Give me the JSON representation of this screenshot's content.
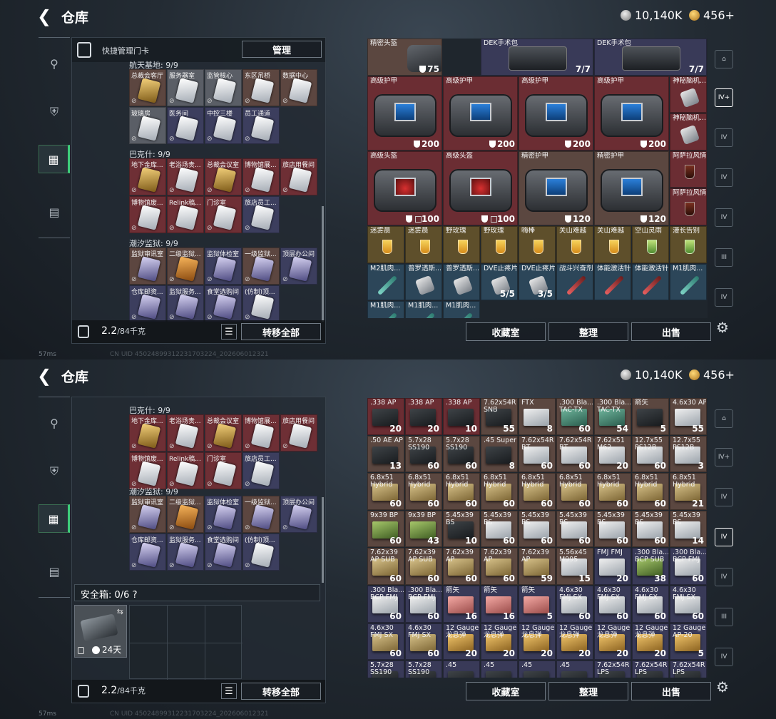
{
  "top": {
    "title": "仓库",
    "silver": "10,140K",
    "gold": "456+"
  },
  "left_panel": {
    "quick_title": "快捷管理门卡",
    "manage": "管理",
    "weight_value": "2.2",
    "weight_unit": "/84千克",
    "transfer_all": "转移全部",
    "groups": [
      {
        "title": "航天基地: 9/9",
        "keys": [
          [
            "总裁会客厅",
            "gold",
            "brown"
          ],
          [
            "服务器室",
            "white",
            "gray"
          ],
          [
            "监管核心",
            "white",
            "gray"
          ],
          [
            "东区吊桥",
            "white",
            "brown"
          ],
          [
            "数据中心",
            "white",
            "brown"
          ],
          [
            "玻璃房",
            "white",
            "gray"
          ],
          [
            "医务间",
            "white",
            "purple"
          ],
          [
            "中控三楼",
            "white",
            "purple"
          ],
          [
            "员工通道",
            "white",
            "purple"
          ]
        ]
      },
      {
        "title": "巴克什: 9/9",
        "keys": [
          [
            "地下金库...",
            "gold",
            "red"
          ],
          [
            "老浴场贵...",
            "white",
            "red"
          ],
          [
            "总裁会议室",
            "gold",
            "red"
          ],
          [
            "博物馆展...",
            "white",
            "red"
          ],
          [
            "旅店用餐间",
            "white",
            "red"
          ],
          [
            "博物馆废...",
            "white",
            "red"
          ],
          [
            "Relink稿...",
            "white",
            "red"
          ],
          [
            "门诊室",
            "white",
            "red"
          ],
          [
            "旅店员工...",
            "white",
            "purple"
          ]
        ]
      },
      {
        "title": "潮汐监狱: 9/9",
        "keys": [
          [
            "监狱审讯室",
            "purple",
            "brown"
          ],
          [
            "二级监狱...",
            "orange",
            "brown"
          ],
          [
            "监狱体检室",
            "purple",
            "purple"
          ],
          [
            "一级监狱...",
            "purple",
            "brown"
          ],
          [
            "顶层办公间",
            "purple",
            "purple"
          ],
          [
            "仓库邮资...",
            "purple",
            "purple"
          ],
          [
            "监狱服务...",
            "purple",
            "purple"
          ],
          [
            "食堂选购间",
            "purple",
            "purple"
          ],
          [
            "(仿制)顶...",
            "white",
            "purple"
          ]
        ]
      }
    ],
    "safe_title": "安全箱: 0/6",
    "safe_help": "?",
    "safe_time": "24天"
  },
  "right_buttons": {
    "collection": "收藏室",
    "sort": "整理",
    "sell": "出售"
  },
  "gear_items": [
    {
      "n": "精密头盔",
      "q": "75",
      "x": 0,
      "y": 0,
      "w": 2,
      "h": 1,
      "bg": "rbrown",
      "t": "helm",
      "shield": true
    },
    {
      "n": "DEK手术包",
      "q": "7/7",
      "x": 3,
      "y": 0,
      "w": 3,
      "h": 1,
      "bg": "rpurple",
      "t": "kit"
    },
    {
      "n": "DEK手术包",
      "q": "7/7",
      "x": 6,
      "y": 0,
      "w": 3,
      "h": 1,
      "bg": "rpurple",
      "t": "kit"
    },
    {
      "n": "高级护甲",
      "q": "200",
      "x": 0,
      "y": 1,
      "w": 2,
      "h": 2,
      "bg": "rred",
      "t": "armor",
      "shield": true
    },
    {
      "n": "高级护甲",
      "q": "200",
      "x": 2,
      "y": 1,
      "w": 2,
      "h": 2,
      "bg": "rred",
      "t": "armor",
      "shield": true
    },
    {
      "n": "高级护甲",
      "q": "200",
      "x": 4,
      "y": 1,
      "w": 2,
      "h": 2,
      "bg": "rred",
      "t": "armor",
      "shield": true
    },
    {
      "n": "高级护甲",
      "q": "200",
      "x": 6,
      "y": 1,
      "w": 2,
      "h": 2,
      "bg": "rred",
      "t": "armor",
      "shield": true
    },
    {
      "n": "神秘脑机...",
      "q": "",
      "x": 8,
      "y": 1,
      "w": 1,
      "h": 1,
      "bg": "rred",
      "t": "pill"
    },
    {
      "n": "神秘脑机...",
      "q": "",
      "x": 8,
      "y": 2,
      "w": 1,
      "h": 1,
      "bg": "rred",
      "t": "pill"
    },
    {
      "n": "高级头盔",
      "q": "100",
      "x": 0,
      "y": 3,
      "w": 2,
      "h": 2,
      "bg": "rred",
      "t": "helmet",
      "shield": true,
      "lt": true
    },
    {
      "n": "高级头盔",
      "q": "100",
      "x": 2,
      "y": 3,
      "w": 2,
      "h": 2,
      "bg": "rred",
      "t": "helmet",
      "shield": true,
      "lt": true
    },
    {
      "n": "精密护甲",
      "q": "120",
      "x": 4,
      "y": 3,
      "w": 2,
      "h": 2,
      "bg": "rbrown",
      "t": "armor",
      "shield": true
    },
    {
      "n": "精密护甲",
      "q": "120",
      "x": 6,
      "y": 3,
      "w": 2,
      "h": 2,
      "bg": "rbrown",
      "t": "armor",
      "shield": true
    },
    {
      "n": "阿萨拉风情...",
      "q": "",
      "x": 8,
      "y": 3,
      "w": 1,
      "h": 1,
      "bg": "rred",
      "t": "drinkdark"
    },
    {
      "n": "阿萨拉风情...",
      "q": "",
      "x": 8,
      "y": 4,
      "w": 1,
      "h": 1,
      "bg": "rred",
      "t": "drinkdark"
    },
    {
      "n": "迷雾晨",
      "q": "",
      "x": 0,
      "y": 5,
      "w": 1,
      "h": 1,
      "bg": "rgold",
      "t": "drink"
    },
    {
      "n": "迷雾晨",
      "q": "",
      "x": 1,
      "y": 5,
      "w": 1,
      "h": 1,
      "bg": "rgold",
      "t": "drink"
    },
    {
      "n": "野玫瑰",
      "q": "",
      "x": 2,
      "y": 5,
      "w": 1,
      "h": 1,
      "bg": "rgold",
      "t": "drink"
    },
    {
      "n": "野玫瑰",
      "q": "",
      "x": 3,
      "y": 5,
      "w": 1,
      "h": 1,
      "bg": "rgold",
      "t": "drink"
    },
    {
      "n": "嗨棒",
      "q": "",
      "x": 4,
      "y": 5,
      "w": 1,
      "h": 1,
      "bg": "rgold",
      "t": "drink"
    },
    {
      "n": "关山难越",
      "q": "",
      "x": 5,
      "y": 5,
      "w": 1,
      "h": 1,
      "bg": "rgold",
      "t": "drink"
    },
    {
      "n": "关山难越",
      "q": "",
      "x": 6,
      "y": 5,
      "w": 1,
      "h": 1,
      "bg": "rgold",
      "t": "drink"
    },
    {
      "n": "空山灵雨",
      "q": "",
      "x": 7,
      "y": 5,
      "w": 1,
      "h": 1,
      "bg": "rgold",
      "t": "drinkgreen"
    },
    {
      "n": "漫长告别",
      "q": "",
      "x": 8,
      "y": 5,
      "w": 1,
      "h": 1,
      "bg": "rgold",
      "t": "drinkgreen"
    },
    {
      "n": "M2肌肉...",
      "q": "",
      "x": 0,
      "y": 6,
      "w": 1,
      "h": 1,
      "bg": "rblue",
      "t": "inj"
    },
    {
      "n": "普罗透斯...",
      "q": "",
      "x": 1,
      "y": 6,
      "w": 1,
      "h": 1,
      "bg": "rblue",
      "t": "pill"
    },
    {
      "n": "普罗透斯...",
      "q": "",
      "x": 2,
      "y": 6,
      "w": 1,
      "h": 1,
      "bg": "rblue",
      "t": "pill"
    },
    {
      "n": "DVE止疼片",
      "q": "5/5",
      "x": 3,
      "y": 6,
      "w": 1,
      "h": 1,
      "bg": "rblue",
      "t": "pill"
    },
    {
      "n": "DVE止疼片",
      "q": "3/5",
      "x": 4,
      "y": 6,
      "w": 1,
      "h": 1,
      "bg": "rblue",
      "t": "pill"
    },
    {
      "n": "战斗兴奋剂",
      "q": "",
      "x": 5,
      "y": 6,
      "w": 1,
      "h": 1,
      "bg": "rblue",
      "t": "injred"
    },
    {
      "n": "体能激活针",
      "q": "",
      "x": 6,
      "y": 6,
      "w": 1,
      "h": 1,
      "bg": "rblue",
      "t": "injred"
    },
    {
      "n": "体能激活针",
      "q": "",
      "x": 7,
      "y": 6,
      "w": 1,
      "h": 1,
      "bg": "rblue",
      "t": "injred"
    },
    {
      "n": "M1肌肉...",
      "q": "",
      "x": 8,
      "y": 6,
      "w": 1,
      "h": 1,
      "bg": "rblue",
      "t": "inj"
    },
    {
      "n": "M1肌肉...",
      "q": "",
      "x": 0,
      "y": 7,
      "w": 1,
      "h": 1,
      "bg": "rblue",
      "t": "inj"
    },
    {
      "n": "M1肌肉...",
      "q": "",
      "x": 1,
      "y": 7,
      "w": 1,
      "h": 1,
      "bg": "rblue",
      "t": "inj"
    },
    {
      "n": "M1肌肉...",
      "q": "",
      "x": 2,
      "y": 7,
      "w": 1,
      "h": 1,
      "bg": "rblue",
      "t": "inj"
    }
  ],
  "ammo_rows": [
    [
      [
        ".338 AP",
        "20",
        "rred",
        "gray"
      ],
      [
        ".338 AP",
        "20",
        "rred",
        "gray"
      ],
      [
        ".338 AP",
        "10",
        "rred",
        "gray"
      ],
      [
        "7.62x54R SNB",
        "55",
        "rbrown",
        "gray"
      ],
      [
        "FTX",
        "8",
        "rbrown",
        "white"
      ],
      [
        ".300 Bla... TAC-TX",
        "60",
        "rbrown",
        "teal"
      ],
      [
        ".300 Bla... TAC-TX",
        "54",
        "rbrown",
        "teal"
      ],
      [
        "箭矢",
        "5",
        "rbrown",
        "gray"
      ],
      [
        "4.6x30 AP",
        "55",
        "rbrown",
        "white"
      ]
    ],
    [
      [
        ".50 AE AP",
        "13",
        "rbrown",
        "gray"
      ],
      [
        "5.7x28 SS190",
        "60",
        "rbrown",
        "gray"
      ],
      [
        "5.7x28 SS190",
        "60",
        "rbrown",
        "gray"
      ],
      [
        ".45 Super",
        "8",
        "rbrown",
        "gray"
      ],
      [
        "7.62x54R BT",
        "60",
        "rbrown",
        "white"
      ],
      [
        "7.62x54R BT",
        "60",
        "rbrown",
        "white"
      ],
      [
        "7.62x51 M62",
        "20",
        "rbrown",
        "white"
      ],
      [
        "12.7x55 PS12B",
        "60",
        "rbrown",
        "white"
      ],
      [
        "12.7x55 PS12B",
        "3",
        "rbrown",
        "white"
      ]
    ],
    [
      [
        "6.8x51 Hybrid",
        "60",
        "rbrown",
        "tan"
      ],
      [
        "6.8x51 Hybrid",
        "60",
        "rbrown",
        "tan"
      ],
      [
        "6.8x51 Hybrid",
        "60",
        "rbrown",
        "tan"
      ],
      [
        "6.8x51 Hybrid",
        "60",
        "rbrown",
        "tan"
      ],
      [
        "6.8x51 Hybrid",
        "60",
        "rbrown",
        "tan"
      ],
      [
        "6.8x51 Hybrid",
        "60",
        "rbrown",
        "tan"
      ],
      [
        "6.8x51 Hybrid",
        "60",
        "rbrown",
        "tan"
      ],
      [
        "6.8x51 Hybrid",
        "60",
        "rbrown",
        "tan"
      ],
      [
        "6.8x51 Hybrid",
        "21",
        "rbrown",
        "tan"
      ]
    ],
    [
      [
        "9x39 BP",
        "60",
        "rbrown",
        "green"
      ],
      [
        "9x39 BP",
        "43",
        "rbrown",
        "green"
      ],
      [
        "5.45x39 BS",
        "10",
        "rbrown",
        "gray"
      ],
      [
        "5.45x39 BS",
        "60",
        "rbrown",
        "white"
      ],
      [
        "5.45x39 BS",
        "60",
        "rbrown",
        "white"
      ],
      [
        "5.45x39 BS",
        "60",
        "rbrown",
        "white"
      ],
      [
        "5.45x39 BS",
        "60",
        "rbrown",
        "white"
      ],
      [
        "5.45x39 BS",
        "60",
        "rbrown",
        "white"
      ],
      [
        "5.45x39 BS",
        "14",
        "rbrown",
        "white"
      ]
    ],
    [
      [
        "7.62x39 AP SUB",
        "60",
        "rbrown",
        "tan"
      ],
      [
        "7.62x39 AP SUB",
        "60",
        "rbrown",
        "tan"
      ],
      [
        "7.62x39 AP",
        "60",
        "rbrown",
        "tan"
      ],
      [
        "7.62x39 AP",
        "60",
        "rbrown",
        "tan"
      ],
      [
        "7.62x39 AP",
        "59",
        "rbrown",
        "tan"
      ],
      [
        "5.56x45 M995",
        "15",
        "rbrown",
        "white"
      ],
      [
        "FMJ FMJ",
        "20",
        "rpurple",
        "white"
      ],
      [
        ".300 Bla... BCP SUB",
        "38",
        "rpurple",
        "green"
      ],
      [
        ".300 Bla... BCP FMJ",
        "60",
        "rpurple",
        "white"
      ]
    ],
    [
      [
        ".300 Bla... BCP FMJ",
        "60",
        "rpurple",
        "white"
      ],
      [
        ".300 Bla... BCP FMJ",
        "60",
        "rpurple",
        "white"
      ],
      [
        "箭矢",
        "16",
        "rpurple",
        "pink"
      ],
      [
        "箭矢",
        "16",
        "rpurple",
        "pink"
      ],
      [
        "箭矢",
        "5",
        "rpurple",
        "pink"
      ],
      [
        "4.6x30 FMJ SX",
        "60",
        "rpurple",
        "white"
      ],
      [
        "4.6x30 FMJ SX",
        "60",
        "rpurple",
        "white"
      ],
      [
        "4.6x30 FMJ SX",
        "60",
        "rpurple",
        "white"
      ],
      [
        "4.6x30 FMJ SX",
        "60",
        "rpurple",
        "white"
      ]
    ],
    [
      [
        "4.6x30 FMJ SX",
        "60",
        "rpurple",
        "tan"
      ],
      [
        "4.6x30 FMJ SX",
        "60",
        "rpurple",
        "tan"
      ],
      [
        "12 Gauge 龙息弹",
        "20",
        "rpurple",
        "gold"
      ],
      [
        "12 Gauge 龙息弹",
        "20",
        "rpurple",
        "gold"
      ],
      [
        "12 Gauge 龙息弹",
        "20",
        "rpurple",
        "gold"
      ],
      [
        "12 Gauge 龙息弹",
        "20",
        "rpurple",
        "gold"
      ],
      [
        "12 Gauge 龙息弹",
        "20",
        "rpurple",
        "gold"
      ],
      [
        "12 Gauge 龙息弹",
        "20",
        "rpurple",
        "gold"
      ],
      [
        "12 Gauge AP-20",
        "5",
        "rpurple",
        "gold"
      ]
    ],
    [
      [
        "5.7x28 SS190",
        "",
        "rpurple",
        "gray"
      ],
      [
        "5.7x28 SS190",
        "",
        "rpurple",
        "gray"
      ],
      [
        ".45",
        "",
        "rpurple",
        "gray"
      ],
      [
        ".45",
        "",
        "rpurple",
        "gray"
      ],
      [
        ".45",
        "",
        "rpurple",
        "gray"
      ],
      [
        ".45",
        "",
        "rpurple",
        "gray"
      ],
      [
        "7.62x54R LPS",
        "",
        "rpurple",
        "gray"
      ],
      [
        "7.62x54R LPS",
        "",
        "rpurple",
        "gray"
      ],
      [
        "7.62x54R LPS",
        "",
        "rpurple",
        "gray"
      ]
    ]
  ],
  "footer": {
    "ping": "57ms",
    "uid": "CN UID 45024899312231703224_202606012321"
  }
}
